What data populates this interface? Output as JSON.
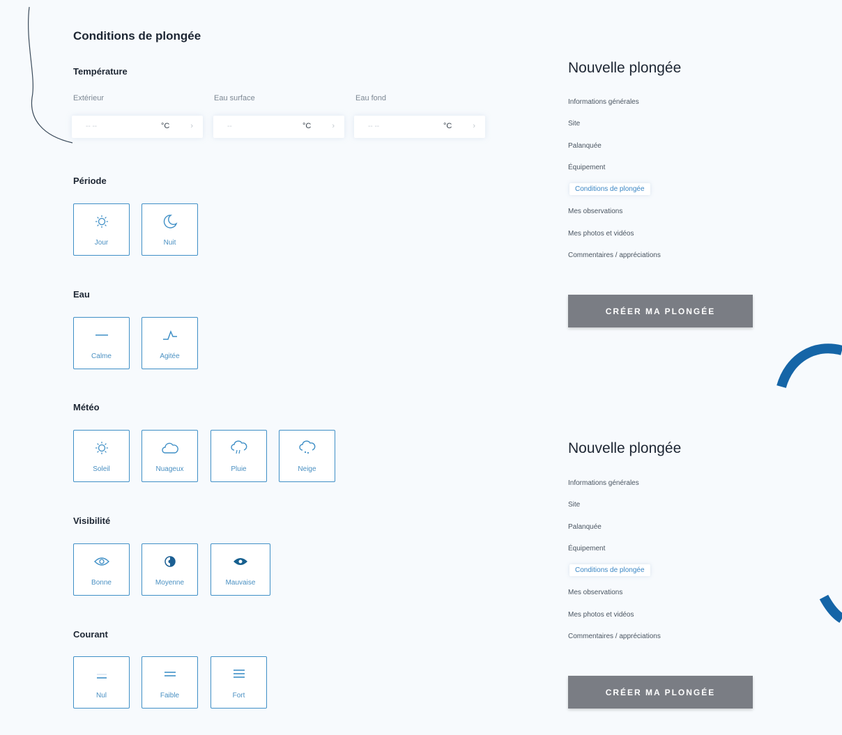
{
  "page_title": "Conditions de plongée",
  "temperature": {
    "title": "Température",
    "fields": [
      {
        "label": "Extérieur",
        "placeholder": "-- --",
        "unit": "°C"
      },
      {
        "label": "Eau surface",
        "placeholder": "--",
        "unit": "°C"
      },
      {
        "label": "Eau fond",
        "placeholder": "-- --",
        "unit": "°C"
      }
    ]
  },
  "periode": {
    "title": "Période",
    "options": [
      {
        "label": "Jour",
        "icon": "sun-icon"
      },
      {
        "label": "Nuit",
        "icon": "moon-icon"
      }
    ]
  },
  "eau": {
    "title": "Eau",
    "options": [
      {
        "label": "Calme",
        "icon": "flat-water-icon"
      },
      {
        "label": "Agitée",
        "icon": "wave-icon"
      }
    ]
  },
  "meteo": {
    "title": "Météo",
    "options": [
      {
        "label": "Soleil",
        "icon": "sun-icon"
      },
      {
        "label": "Nuageux",
        "icon": "cloud-icon"
      },
      {
        "label": "Pluie",
        "icon": "rain-icon"
      },
      {
        "label": "Neige",
        "icon": "snow-icon"
      }
    ]
  },
  "visibilite": {
    "title": "Visibilité",
    "options": [
      {
        "label": "Bonne",
        "icon": "eye-icon"
      },
      {
        "label": "Moyenne",
        "icon": "half-eye-icon"
      },
      {
        "label": "Mauvaise",
        "icon": "closed-eye-icon"
      }
    ]
  },
  "courant": {
    "title": "Courant",
    "options": [
      {
        "label": "Nul",
        "icon": "no-current-icon"
      },
      {
        "label": "Faible",
        "icon": "weak-current-icon"
      },
      {
        "label": "Fort",
        "icon": "strong-current-icon"
      }
    ]
  },
  "panels": [
    {
      "title": "Nouvelle plongée",
      "nav": [
        "Informations générales",
        "Site",
        "Palanquée",
        "Équipement",
        "Conditions de plongée",
        "Mes observations",
        "Mes photos et vidéos",
        "Commentaires / appréciations"
      ],
      "active_index": 4,
      "button": "CRÉER MA PLONGÉE"
    },
    {
      "title": "Nouvelle plongée",
      "nav": [
        "Informations générales",
        "Site",
        "Palanquée",
        "Équipement",
        "Conditions de plongée",
        "Mes observations",
        "Mes photos et vidéos",
        "Commentaires / appréciations"
      ],
      "active_index": 4,
      "button": "CRÉER MA PLONGÉE"
    }
  ],
  "colors": {
    "accent": "#3f8fc6",
    "button": "#7a7d84",
    "arc": "#1565a7"
  }
}
